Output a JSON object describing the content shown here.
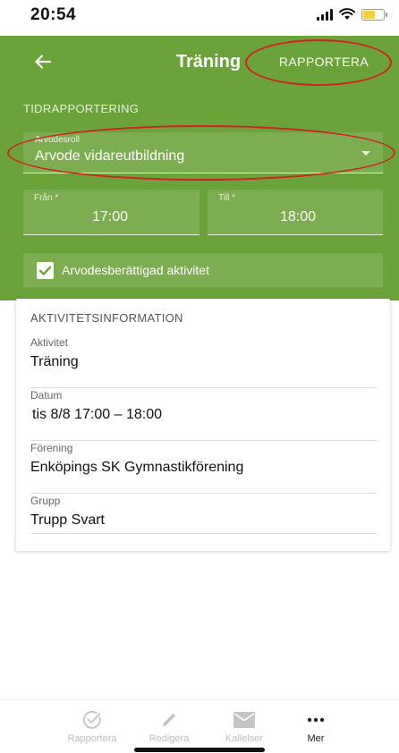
{
  "status_bar": {
    "time": "20:54",
    "icons": [
      "signal-icon",
      "wifi-icon",
      "battery-icon"
    ],
    "battery_color": "#f4d03f"
  },
  "app_bar": {
    "back_icon": "arrow-left-icon",
    "title": "Träning",
    "report_label": "RAPPORTERA"
  },
  "time_reporting": {
    "section_title": "TIDRAPPORTERING",
    "role_label": "Arvodesroll",
    "role_value": "Arvode vidareutbildning",
    "from_label": "Från *",
    "from_value": "17:00",
    "to_label": "Till *",
    "to_value": "18:00",
    "eligible_label": "Arvodesberättigad aktivitet",
    "eligible_checked": true
  },
  "activity_info": {
    "heading": "AKTIVITETSINFORMATION",
    "rows": [
      {
        "label": "Aktivitet",
        "value": "Träning"
      },
      {
        "label": "Datum",
        "value": "tis 8/8 17:00 – 18:00"
      },
      {
        "label": "Förening",
        "value": "Enköpings SK Gymnastikförening"
      },
      {
        "label": "Grupp",
        "value": "Trupp Svart"
      }
    ]
  },
  "bottom_nav": {
    "items": [
      {
        "label": "Rapportera",
        "icon": "check-circle-icon",
        "active": false
      },
      {
        "label": "Redigera",
        "icon": "pencil-icon",
        "active": false
      },
      {
        "label": "Kallelser",
        "icon": "envelope-icon",
        "active": false
      },
      {
        "label": "Mer",
        "icon": "more-dots-icon",
        "active": true
      }
    ]
  },
  "colors": {
    "header_green": "#6aa33a",
    "annotation_red": "#d42020"
  }
}
